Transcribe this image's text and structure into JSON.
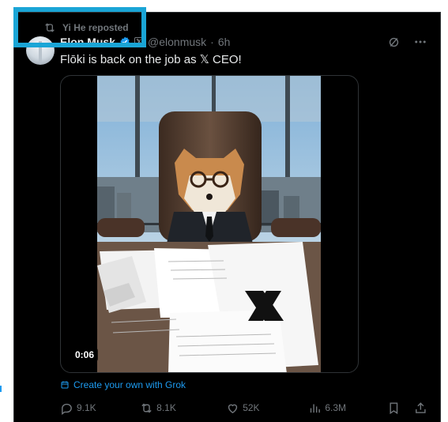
{
  "repost": {
    "label": "Yi He reposted"
  },
  "author": {
    "name": "Elon Musk",
    "handle": "@elonmusk",
    "separator": "·",
    "time": "6h"
  },
  "post": {
    "text": "Flōki is back on the job as 𝕏 CEO!"
  },
  "media": {
    "duration": "0:06"
  },
  "grok": {
    "label": "Create your own with Grok"
  },
  "stats": {
    "replies": "9.1K",
    "reposts": "8.1K",
    "likes": "52K",
    "views": "6.3M"
  },
  "colors": {
    "accent": "#1d9bf0",
    "muted": "#71767b",
    "highlight": "#1aa5d6",
    "background": "#000000"
  },
  "icons": [
    "repost-icon",
    "verified-icon",
    "x-affiliation-icon",
    "grok-icon",
    "more-icon",
    "reply-icon",
    "like-icon",
    "views-icon",
    "bookmark-icon",
    "share-icon"
  ]
}
